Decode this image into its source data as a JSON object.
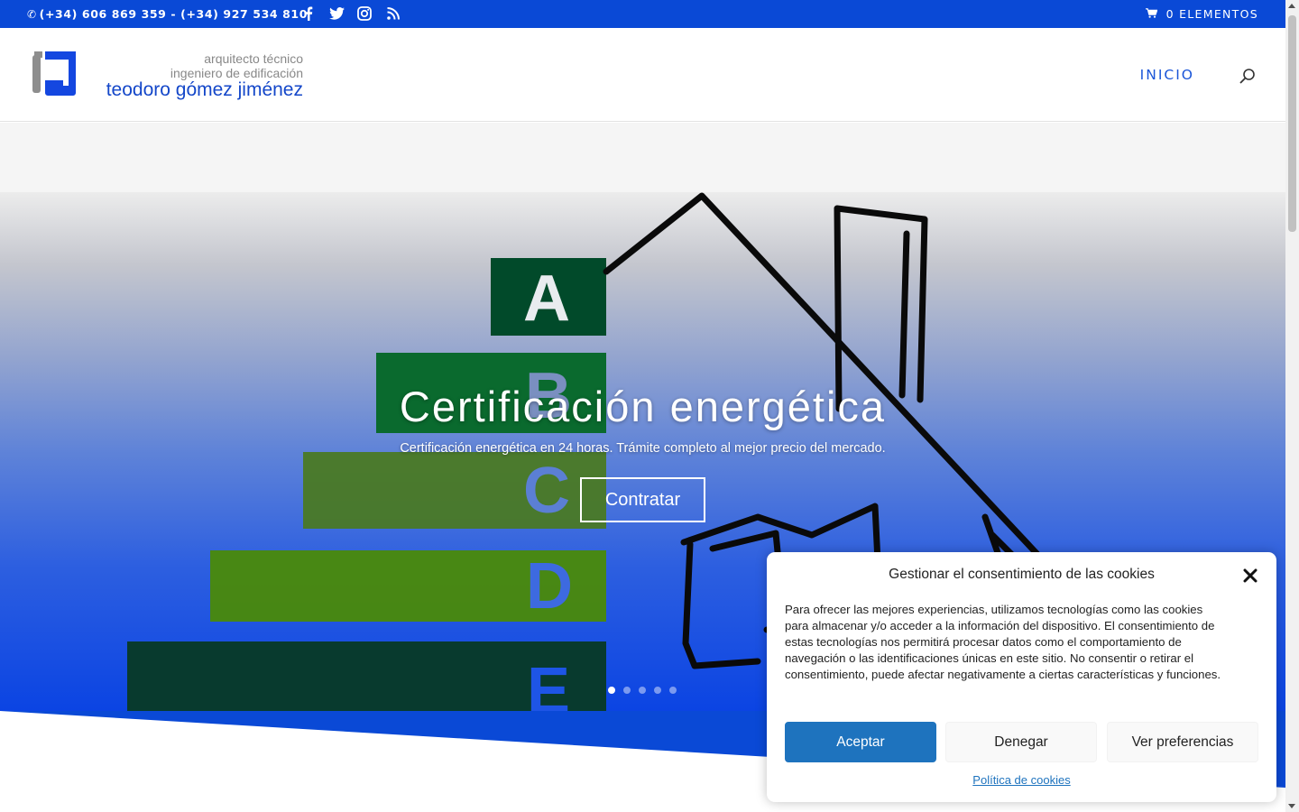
{
  "topbar": {
    "phone": "(+34) 606 869 359 - (+34) 927 534 810",
    "social": [
      "facebook-icon",
      "twitter-icon",
      "instagram-icon",
      "rss-icon"
    ],
    "cart": "0 ELEMENTOS",
    "bg_color": "#0a49d6"
  },
  "logo": {
    "line1": "arquitecto técnico",
    "line2": "ingeniero de edificación",
    "line3": "teodoro gómez jiménez"
  },
  "nav": {
    "items": [
      {
        "label": "INICIO"
      }
    ],
    "search_icon": "search-icon"
  },
  "hero": {
    "title": "Certificación energética",
    "subtitle": "Certificación energética en 24 horas. Trámite completo al mejor precio del mercado.",
    "button": "Contratar",
    "energy_labels": [
      "A",
      "B",
      "C",
      "D",
      "E"
    ],
    "slides_count": 5,
    "active_slide": 1
  },
  "cookie": {
    "title": "Gestionar el consentimiento de las cookies",
    "body": "Para ofrecer las mejores experiencias, utilizamos tecnologías como las cookies para almacenar y/o acceder a la información del dispositivo. El consentimiento de estas tecnologías nos permitirá procesar datos como el comportamiento de navegación o las identificaciones únicas en este sitio. No consentir o retirar el consentimiento, puede afectar negativamente a ciertas características y funciones.",
    "accept": "Aceptar",
    "deny": "Denegar",
    "preferences": "Ver preferencias",
    "policy_link": "Política de cookies",
    "accent_color": "#1e73be"
  }
}
